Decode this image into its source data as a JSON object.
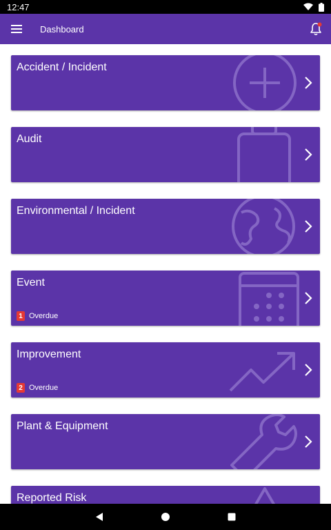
{
  "status_bar": {
    "time": "12:47"
  },
  "app_bar": {
    "title": "Dashboard",
    "menu_icon": "hamburger-menu-icon",
    "notification_icon": "bell-icon",
    "notification_dot_color": "#e53935"
  },
  "colors": {
    "primary": "#5b34a8",
    "badge": "#e53935",
    "background": "#ffffff"
  },
  "cards": [
    {
      "title": "Accident / Incident",
      "icon": "plus-circle-icon"
    },
    {
      "title": "Audit",
      "icon": "clipboard-icon"
    },
    {
      "title": "Environmental / Incident",
      "icon": "globe-icon"
    },
    {
      "title": "Event",
      "icon": "calendar-icon",
      "overdue_count": "1",
      "overdue_label": "Overdue"
    },
    {
      "title": "Improvement",
      "icon": "trending-up-icon",
      "overdue_count": "2",
      "overdue_label": "Overdue"
    },
    {
      "title": "Plant & Equipment",
      "icon": "wrench-icon"
    },
    {
      "title": "Reported Risk",
      "icon": "warning-icon"
    }
  ],
  "nav_bar": {
    "back_icon": "back-icon",
    "home_icon": "home-icon",
    "recents_icon": "recents-icon"
  }
}
